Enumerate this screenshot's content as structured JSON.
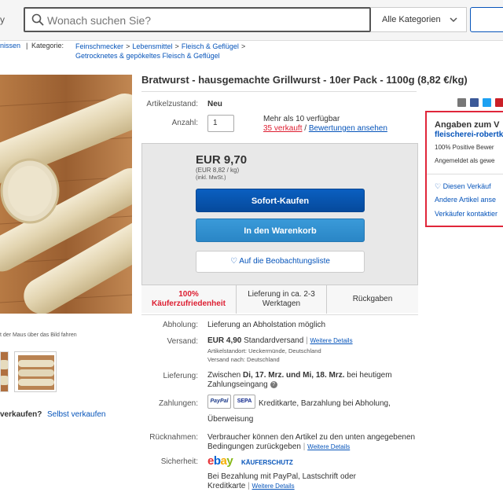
{
  "header": {
    "logo_fragment": "y",
    "search": {
      "placeholder": "Wonach suchen Sie?",
      "icon": "search-icon"
    },
    "category": {
      "label": "Alle Kategorien",
      "icon": "chevron-down-icon"
    }
  },
  "breadcrumb": {
    "back_link": "nissen",
    "separator": "|",
    "category_label": "Kategorie:",
    "items": [
      "Feinschmecker",
      "Lebensmittel",
      "Fleisch & Geflügel",
      "Getrocknetes & gepökeltes Fleisch & Geflügel"
    ],
    "arrow": ">"
  },
  "gallery": {
    "hover_hint": "t der Maus über das Bild fahren",
    "sell_question": "verkaufen?",
    "sell_link": "Selbst verkaufen"
  },
  "listing": {
    "title": "Bratwurst - hausgemachte Grillwurst - 10er Pack - 1100g (8,82 €/kg)",
    "condition_label": "Artikelzustand:",
    "condition_value": "Neu",
    "quantity_label": "Anzahl:",
    "quantity_value": "1",
    "availability": "Mehr als 10 verfügbar",
    "sold": "35 verkauft",
    "sold_sep": "/",
    "reviews_link": "Bewertungen ansehen",
    "share_icons": [
      "email-icon",
      "facebook-icon",
      "twitter-icon",
      "pinterest-icon"
    ]
  },
  "buybox": {
    "price": "EUR 9,70",
    "price_per": "(EUR 8,82 / kg)",
    "price_tax": "(inkl. MwSt.)",
    "buy_now": "Sofort-Kaufen",
    "add_to_cart": "In den Warenkorb",
    "watch": "Auf die Beobachtungsliste",
    "features": {
      "satisfaction_line1": "100%",
      "satisfaction_line2": "Käuferzufriedenheit",
      "delivery_line1": "Lieferung in ca. 2-3",
      "delivery_line2": "Werktagen",
      "returns": "Rückgaben"
    }
  },
  "details": {
    "pickup_label": "Abholung:",
    "pickup_value": "Lieferung an Abholstation möglich",
    "shipping_label": "Versand:",
    "shipping_price": "EUR 4,90",
    "shipping_type": "Standardversand",
    "more_details": "Weitere Details",
    "location": "Artikelstandort: Ueckermünde, Deutschland",
    "ships_to": "Versand nach: Deutschland",
    "delivery_label": "Lieferung:",
    "delivery_prefix": "Zwischen",
    "delivery_dates": "Di, 17. Mrz. und Mi, 18. Mrz.",
    "delivery_suffix": "bei heutigem",
    "delivery_line2": "Zahlungseingang",
    "payment_label": "Zahlungen:",
    "payment_paypal": "PayPal",
    "payment_sepa": "SEPA",
    "payment_text": "Kreditkarte, Barzahlung bei Abholung,",
    "payment_text2": "Überweisung",
    "returns_label": "Rücknahmen:",
    "returns_line1": "Verbraucher können den Artikel zu den unten angegebenen",
    "returns_line2": "Bedingungen zurückgeben",
    "security_label": "Sicherheit:",
    "ebay_logo": "ebay",
    "buyer_protection": "KÄUFERSCHUTZ",
    "security_line1": "Bei Bezahlung mit PayPal, Lastschrift oder",
    "security_line2": "Kreditkarte"
  },
  "seller": {
    "heading": "Angaben zum V",
    "name": "fleischerei-robertk",
    "feedback": "100% Positive Bewer",
    "registered": "Angemeldet als gewe",
    "save_seller": "Diesen Verkäuf",
    "other_items": "Andere Artikel anse",
    "contact": "Verkäufer kontaktier"
  }
}
